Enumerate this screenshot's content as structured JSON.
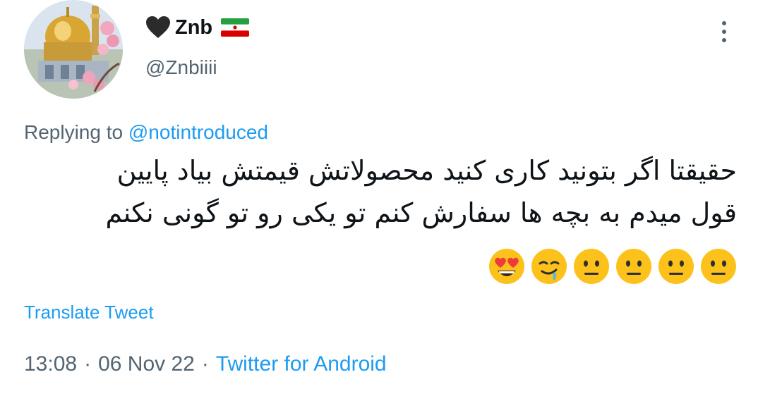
{
  "author": {
    "display_name": "Znb",
    "handle": "@Znbiiii",
    "heart_icon": "black-heart-icon",
    "flag_icon": "iran-flag-icon"
  },
  "reply": {
    "prefix": "Replying to",
    "mention": "@notintroduced"
  },
  "tweet": {
    "lines": [
      "حقیقتا اگر بتونید کاری کنید محصولاتش قیمتش بیاد پایین",
      "قول میدم به بچه ها سفارش کنم تو یکی رو تو گونی نکنم"
    ],
    "emojis": [
      "neutral-face-icon",
      "neutral-face-icon",
      "neutral-face-icon",
      "neutral-face-icon",
      "drooling-face-icon",
      "heart-eyes-face-icon"
    ]
  },
  "translate_label": "Translate Tweet",
  "meta": {
    "time": "13:08",
    "sep1": "·",
    "date": "06 Nov 22",
    "sep2": "·",
    "source": "Twitter for Android"
  },
  "colors": {
    "link": "#1d9bf0",
    "secondary": "#536471",
    "text": "#0f1419"
  }
}
